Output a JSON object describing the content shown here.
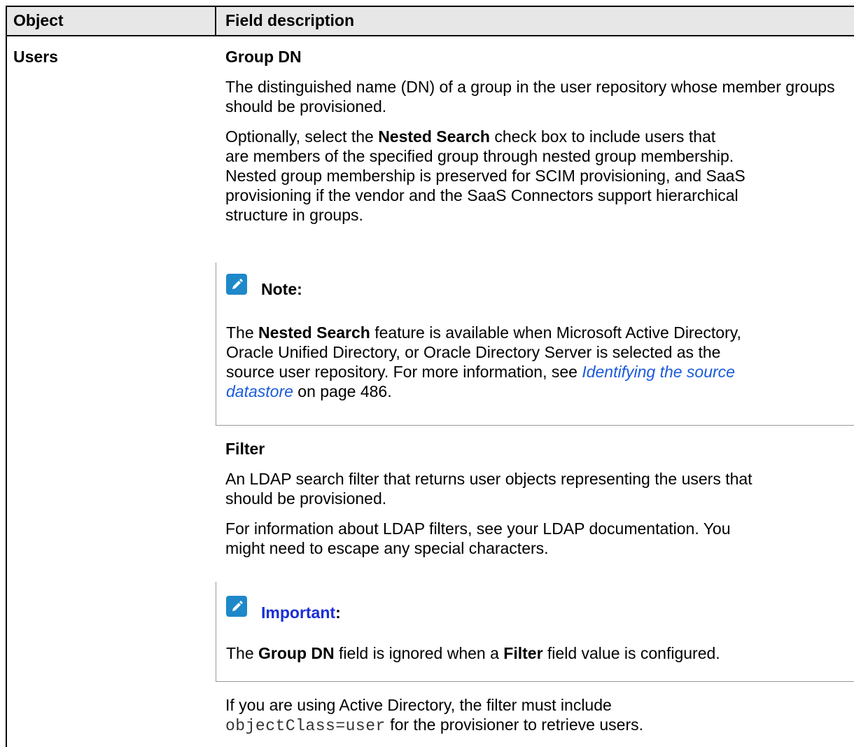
{
  "table": {
    "headers": {
      "object": "Object",
      "field_description": "Field description"
    },
    "row": {
      "object": "Users",
      "group_dn": {
        "heading": "Group DN",
        "para1": "The distinguished name (DN) of a group in the user repository whose member groups should be provisioned.",
        "para2": {
          "l1_pre": "Optionally, select the ",
          "l1_bold": "Nested Search",
          "l1_post": " check box to include users that",
          "l2": "are members of the specified group through nested group membership.",
          "l3": "Nested group membership is preserved for SCIM provisioning, and SaaS",
          "l4": "provisioning if the vendor and the SaaS Connectors support hierarchical",
          "l5": "structure in groups."
        },
        "note": {
          "label": "Note:",
          "icon": "pencil-icon",
          "l1_pre": "The ",
          "l1_bold": "Nested Search",
          "l1_post": " feature is available when Microsoft Active Directory,",
          "l2": "Oracle Unified Directory, or Oracle Directory Server is selected as the",
          "l3_pre": "source user repository. For more information, see ",
          "l3_link": "Identifying the source",
          "l4_link": "datastore",
          "l4_post": " on page 486."
        }
      },
      "filter": {
        "heading": "Filter",
        "para1_l1": "An LDAP search filter that returns user objects representing the users that",
        "para1_l2": "should be provisioned.",
        "para2_l1": "For information about LDAP filters, see your LDAP documentation. You",
        "para2_l2": "might need to escape any special characters.",
        "important": {
          "label": "Important",
          "colon": ":",
          "icon": "pencil-icon",
          "pre": "The ",
          "bold1": "Group DN",
          "mid": " field is ignored when a ",
          "bold2": "Filter",
          "post": " field value is configured."
        },
        "para3_l1": "If you are using Active Directory, the filter must include",
        "para3_code": "objectClass=user",
        "para3_post": " for the provisioner to retrieve users."
      }
    }
  },
  "colors": {
    "header_bg": "#e7e7e7",
    "icon_bg": "#1e88c9",
    "link": "#1a5adc",
    "important": "#1a2fd6"
  }
}
